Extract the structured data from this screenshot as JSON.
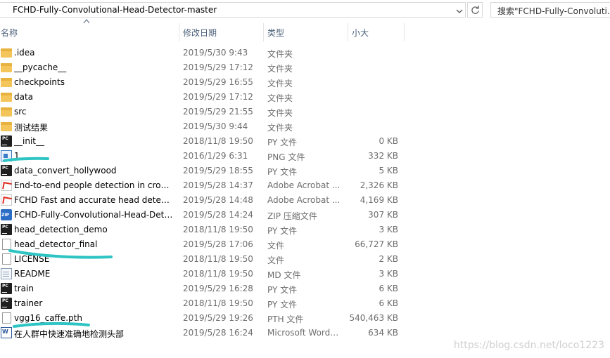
{
  "addressBar": {
    "path": "FCHD-Fully-Convolutional-Head-Detector-master"
  },
  "search": {
    "placeholder": "搜索\"FCHD-Fully-Convoluti..."
  },
  "columns": {
    "name": "名称",
    "date": "修改日期",
    "type": "类型",
    "size": "小大"
  },
  "files": [
    {
      "name": ".idea",
      "date": "2019/5/30 9:43",
      "type": "文件夹",
      "size": "",
      "icon": "folder-icon"
    },
    {
      "name": "__pycache__",
      "date": "2019/5/29 17:12",
      "type": "文件夹",
      "size": "",
      "icon": "folder-icon"
    },
    {
      "name": "checkpoints",
      "date": "2019/5/29 16:55",
      "type": "文件夹",
      "size": "",
      "icon": "folder-icon"
    },
    {
      "name": "data",
      "date": "2019/5/29 17:12",
      "type": "文件夹",
      "size": "",
      "icon": "folder-icon"
    },
    {
      "name": "src",
      "date": "2019/5/29 21:55",
      "type": "文件夹",
      "size": "",
      "icon": "folder-icon"
    },
    {
      "name": "测试结果",
      "date": "2019/5/30 9:44",
      "type": "文件夹",
      "size": "",
      "icon": "folder-icon"
    },
    {
      "name": "__init__",
      "date": "2018/11/8 19:50",
      "type": "PY 文件",
      "size": "0 KB",
      "icon": "pycharm-file-icon"
    },
    {
      "name": "1",
      "date": "2016/1/29 6:31",
      "type": "PNG 文件",
      "size": "332 KB",
      "icon": "image-file-icon"
    },
    {
      "name": "data_convert_hollywood",
      "date": "2019/5/29 18:55",
      "type": "PY 文件",
      "size": "5 KB",
      "icon": "pycharm-file-icon"
    },
    {
      "name": "End-to-end people detection in crow...",
      "date": "2019/5/28 14:37",
      "type": "Adobe Acrobat ...",
      "size": "2,326 KB",
      "icon": "pdf-file-icon"
    },
    {
      "name": "FCHD Fast and accurate head detecti...",
      "date": "2019/5/28 14:48",
      "type": "Adobe Acrobat ...",
      "size": "4,169 KB",
      "icon": "pdf-file-icon"
    },
    {
      "name": "FCHD-Fully-Convolutional-Head-Dete...",
      "date": "2019/5/28 14:24",
      "type": "ZIP 压缩文件",
      "size": "307 KB",
      "icon": "zip-file-icon"
    },
    {
      "name": "head_detection_demo",
      "date": "2018/11/8 19:50",
      "type": "PY 文件",
      "size": "3 KB",
      "icon": "pycharm-file-icon"
    },
    {
      "name": "head_detector_final",
      "date": "2019/5/28 17:06",
      "type": "文件",
      "size": "66,727 KB",
      "icon": "blank-file-icon"
    },
    {
      "name": "LICENSE",
      "date": "2018/11/8 19:50",
      "type": "文件",
      "size": "2 KB",
      "icon": "blank-file-icon"
    },
    {
      "name": "README",
      "date": "2018/11/8 19:50",
      "type": "MD 文件",
      "size": "3 KB",
      "icon": "markdown-file-icon"
    },
    {
      "name": "train",
      "date": "2019/5/29 16:28",
      "type": "PY 文件",
      "size": "6 KB",
      "icon": "pycharm-file-icon"
    },
    {
      "name": "trainer",
      "date": "2018/11/8 19:50",
      "type": "PY 文件",
      "size": "6 KB",
      "icon": "pycharm-file-icon"
    },
    {
      "name": "vgg16_caffe.pth",
      "date": "2019/5/29 19:26",
      "type": "PTH 文件",
      "size": "540,463 KB",
      "icon": "blank-file-icon"
    },
    {
      "name": "在人群中快速准确地检测头部",
      "date": "2019/5/28 16:24",
      "type": "Microsoft Word ...",
      "size": "634 KB",
      "icon": "word-file-icon"
    }
  ],
  "watermark": "https://blog.csdn.net/loco1223",
  "colors": {
    "highlighter": "#2ec4c4",
    "headerText": "#4c607a",
    "folder": "#f4c55a"
  }
}
